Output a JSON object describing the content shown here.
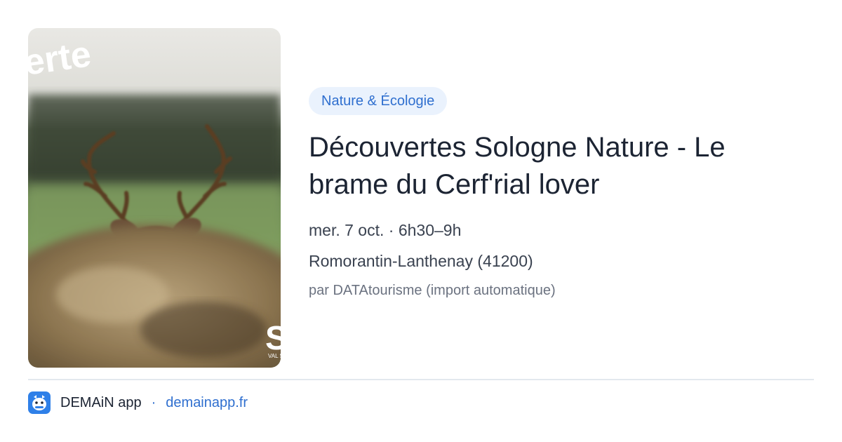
{
  "event": {
    "image_alt": "Deer antlers behind rocks",
    "image_overlay_text": "erte",
    "image_corner_text": "S",
    "image_corner_subtext": "VAL S",
    "category": "Nature & Écologie",
    "title": "Découvertes Sologne Nature - Le brame du Cerf'rial lover",
    "datetime": "mer. 7 oct. · 6h30–9h",
    "location": "Romorantin-Lanthenay (41200)",
    "source": "par DATAtourisme (import automatique)"
  },
  "footer": {
    "app_icon": "demain-app-icon",
    "app_name": "DEMAiN app",
    "separator": "·",
    "domain": "demainapp.fr"
  },
  "colors": {
    "accent": "#2f6fcf",
    "badge_bg": "#eaf2fd",
    "text": "#1c2433",
    "muted": "#6b7280"
  }
}
